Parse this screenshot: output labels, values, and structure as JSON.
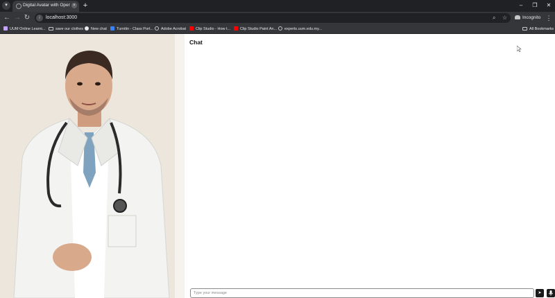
{
  "browser": {
    "tab": {
      "title": "Digital Avatar with OpenVi",
      "close_glyph": "×"
    },
    "new_tab_glyph": "+",
    "window_controls": {
      "minimize": "–",
      "maximize": "❐",
      "close": "✕"
    },
    "nav": {
      "back": "←",
      "forward": "→",
      "reload": "↻"
    },
    "address": {
      "url": "localhost:3000"
    },
    "incognito_label": "Incognito",
    "menu_glyph": "⋮"
  },
  "bookmarks": {
    "items": [
      {
        "label": "UUM Online Learni...",
        "icon": "uum-icon",
        "color": "#c5a3ff"
      },
      {
        "label": "save our clothes",
        "icon": "folder-icon",
        "color": "#c4c7c5"
      },
      {
        "label": "New chat",
        "icon": "openai-icon",
        "color": "#e8eaed"
      },
      {
        "label": "Turnitin - Class Port...",
        "icon": "turnitin-icon",
        "color": "#3b82f6"
      },
      {
        "label": "Adobe Acrobat",
        "icon": "globe-icon",
        "color": "#c4c7c5"
      },
      {
        "label": "Clip Studio - How t...",
        "icon": "youtube-icon",
        "color": "#ff0000"
      },
      {
        "label": "Clip Studio Paint An...",
        "icon": "youtube-icon",
        "color": "#ff0000"
      },
      {
        "label": "experts.uum.edu.my...",
        "icon": "globe-icon",
        "color": "#c4c7c5"
      }
    ],
    "all_bookmarks_label": "All Bookmarks"
  },
  "chat": {
    "title": "Chat",
    "input_placeholder": "Type your message",
    "send_glyph": "➤",
    "mic_glyph": "🎙"
  },
  "avatar": {
    "subject": "doctor-avatar",
    "colors": {
      "coat": "#f3f3f1",
      "tie": "#7fa3bf",
      "skin": "#d9a98c",
      "hair": "#3a2a22",
      "stethoscope": "#2b2b2b"
    }
  }
}
